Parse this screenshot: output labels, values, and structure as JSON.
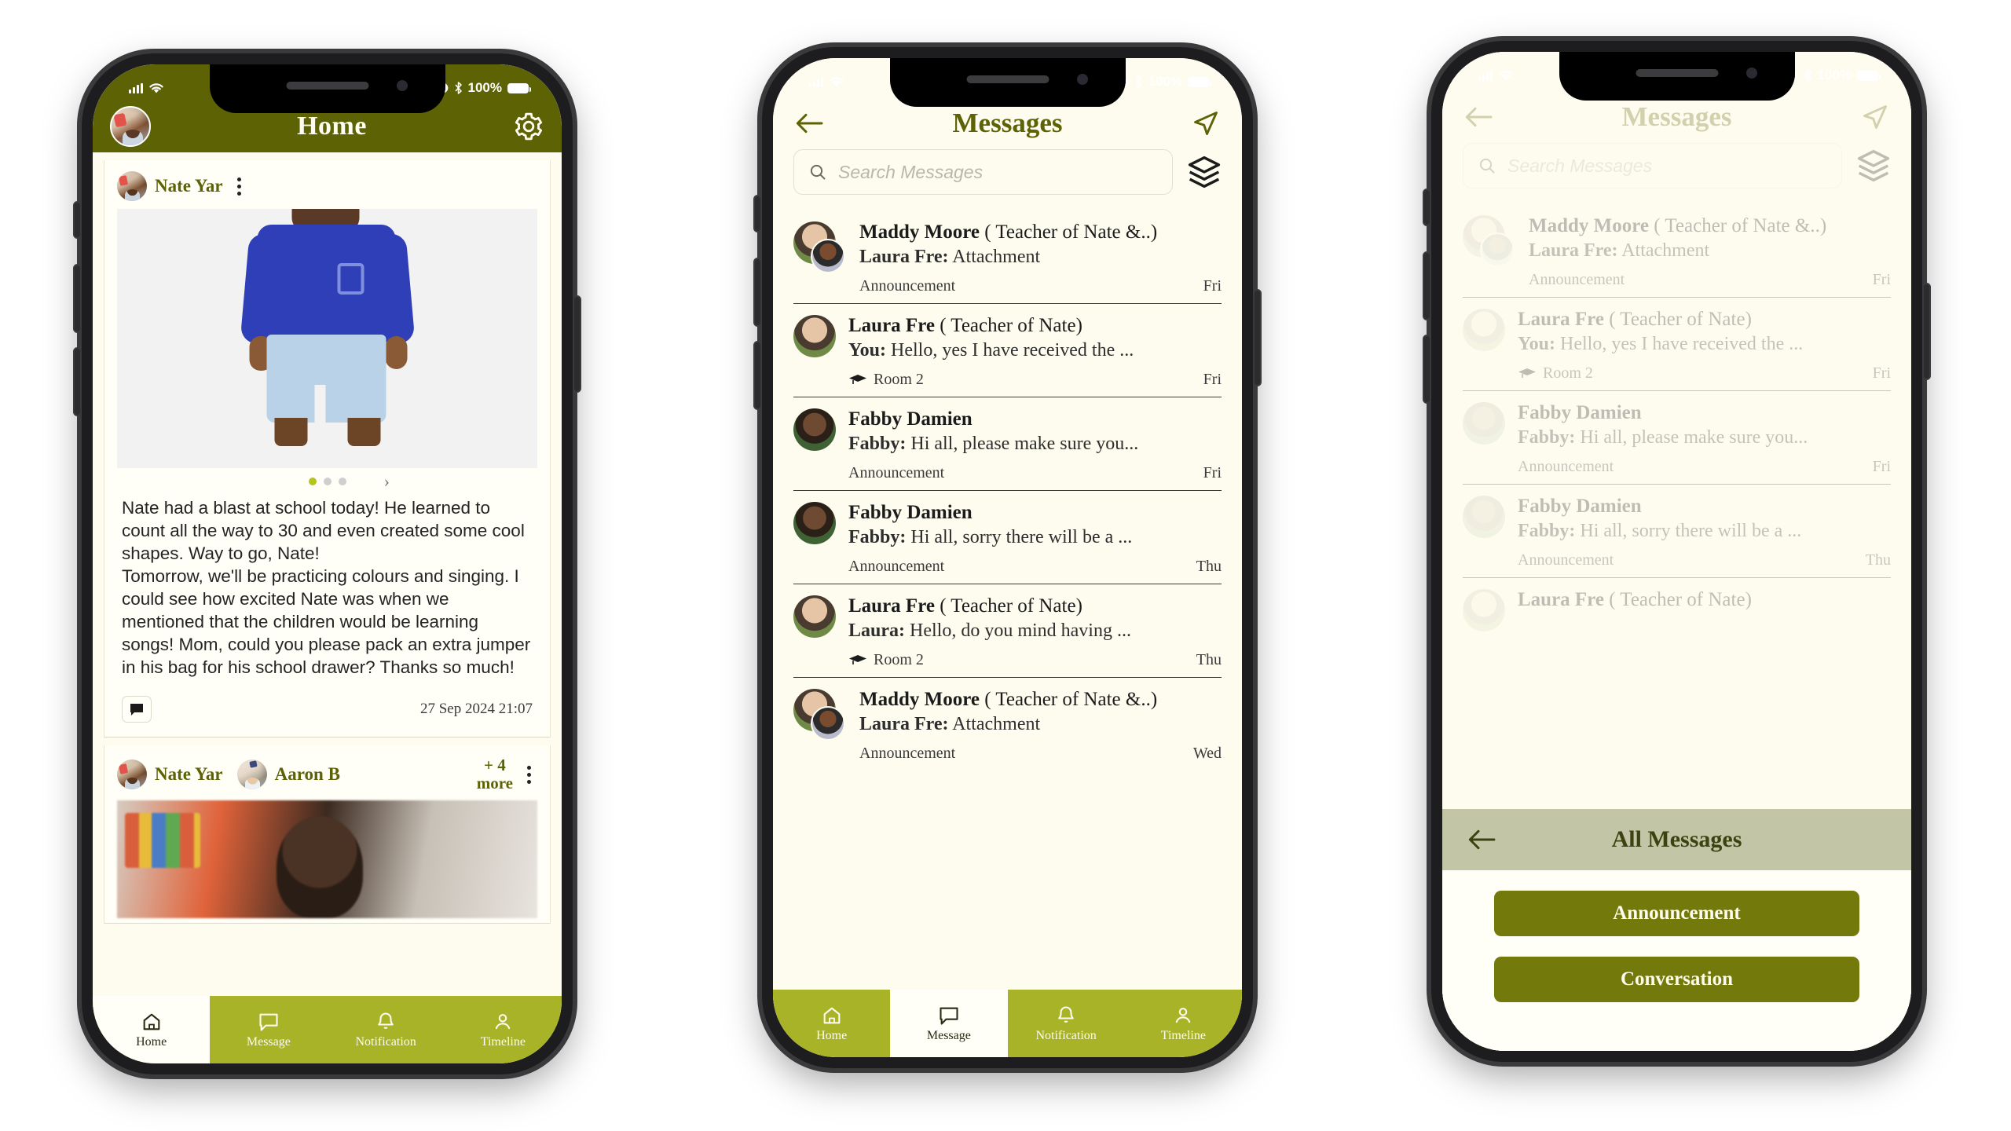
{
  "status_bar": {
    "battery_percent": "100%",
    "icons": [
      "signal-bars",
      "wifi",
      "alarm",
      "bluetooth",
      "battery"
    ]
  },
  "phone1": {
    "header": {
      "title": "Home",
      "avatar": "user-avatar",
      "settings_icon": "gear-icon"
    },
    "posts": [
      {
        "author": "Nate  Yar",
        "menu_icon": "kebab-menu-icon",
        "body": "Nate had a blast at school today! He learned to count all the way to 30 and even created some cool shapes. Way to go, Nate!\nTomorrow, we'll be practicing colours and singing. I could see how excited Nate was when we mentioned that the children would be learning songs! Mom, could you please pack an extra jumper in his bag for his school drawer? Thanks so much!",
        "timestamp": "27 Sep 2024  21:07",
        "comment_icon": "comment-icon",
        "carousel": {
          "total": 3,
          "active": 1,
          "next_icon": "chevron-right-icon"
        }
      },
      {
        "author": "Nate  Yar",
        "author2": "Aaron B",
        "more_count": "+ 4",
        "more_label": "more",
        "menu_icon": "kebab-menu-icon"
      }
    ],
    "bottom_nav": {
      "active": "Home",
      "items": [
        {
          "label": "Home",
          "icon": "home-icon"
        },
        {
          "label": "Message",
          "icon": "message-icon"
        },
        {
          "label": "Notification",
          "icon": "bell-icon"
        },
        {
          "label": "Timeline",
          "icon": "person-icon"
        }
      ]
    }
  },
  "phone2": {
    "header": {
      "back_icon": "back-arrow-icon",
      "title": "Messages",
      "send_icon": "send-icon"
    },
    "search": {
      "placeholder": "Search Messages",
      "value": "",
      "icon": "search-icon",
      "filter_icon": "layers-filter-icon"
    },
    "messages": [
      {
        "name": "Maddy Moore",
        "role": "( Teacher of Nate &..)",
        "sender": "Laura Fre:",
        "preview": " Attachment",
        "tag": "Announcement",
        "tag_icon": "",
        "time": "Fri",
        "avatar": "double-avatar"
      },
      {
        "name": "Laura Fre",
        "role": "( Teacher of Nate)",
        "sender": "You:",
        "preview": " Hello, yes I have received the ...",
        "tag": "Room 2",
        "tag_icon": "graduation-cap-icon",
        "time": "Fri",
        "avatar": "single-avatar"
      },
      {
        "name": "Fabby Damien",
        "role": "",
        "sender": "Fabby:",
        "preview": " Hi all, please make sure you...",
        "tag": "Announcement",
        "tag_icon": "",
        "time": "Fri",
        "avatar": "single-avatar"
      },
      {
        "name": "Fabby Damien",
        "role": "",
        "sender": "Fabby:",
        "preview": " Hi all, sorry there will be a ...",
        "tag": "Announcement",
        "tag_icon": "",
        "time": "Thu",
        "avatar": "single-avatar"
      },
      {
        "name": "Laura Fre",
        "role": "( Teacher of Nate)",
        "sender": "Laura:",
        "preview": " Hello, do you mind having ...",
        "tag": "Room 2",
        "tag_icon": "graduation-cap-icon",
        "time": "Thu",
        "avatar": "single-avatar"
      },
      {
        "name": "Maddy Moore",
        "role": "( Teacher of Nate &..)",
        "sender": "Laura Fre:",
        "preview": " Attachment",
        "tag": "Announcement",
        "tag_icon": "",
        "time": "Wed",
        "avatar": "double-avatar"
      }
    ],
    "bottom_nav": {
      "active": "Message",
      "items": [
        {
          "label": "Home",
          "icon": "home-icon"
        },
        {
          "label": "Message",
          "icon": "message-icon"
        },
        {
          "label": "Notification",
          "icon": "bell-icon"
        },
        {
          "label": "Timeline",
          "icon": "person-icon"
        }
      ]
    }
  },
  "phone3": {
    "header": {
      "back_icon": "back-arrow-icon",
      "title": "Messages",
      "send_icon": "send-icon"
    },
    "search": {
      "placeholder": "Search Messages",
      "value": "",
      "icon": "search-icon",
      "filter_icon": "layers-filter-icon"
    },
    "sheet": {
      "back_icon": "back-arrow-icon",
      "title": "All Messages",
      "options": [
        {
          "label": "Announcement"
        },
        {
          "label": "Conversation"
        }
      ]
    }
  },
  "colors": {
    "olive_header": "#5d6205",
    "olive_nav": "#a8b328",
    "cream_bg": "#fdfcef",
    "button_olive": "#74790c",
    "sheet_head": "#c2c6a6",
    "dot_active": "#b5c41f"
  }
}
